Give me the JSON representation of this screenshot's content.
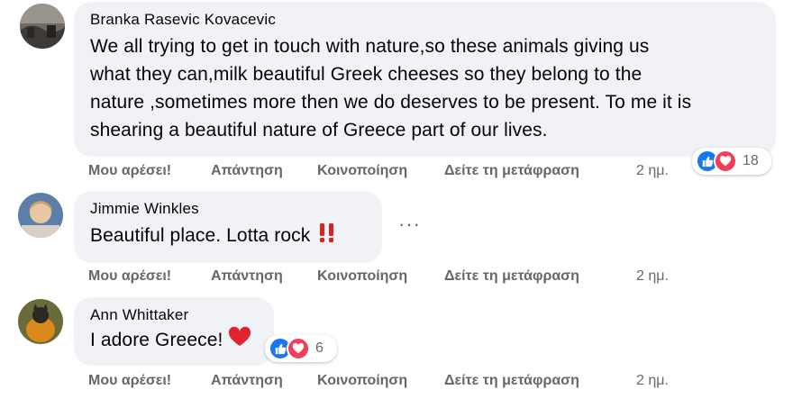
{
  "colors": {
    "bubble": "#f0f2f5",
    "action_text": "#65676b",
    "like_blue": "#1877f2",
    "love_red": "#f33e58",
    "exclamation_red": "#e02020"
  },
  "comments": [
    {
      "author": "Branka Rasevic Kovacevic",
      "lines": [
        "We all trying to get in touch with nature,so these animals giving us",
        "what they can,milk beautiful Greek cheeses so they belong to the",
        "nature ,sometimes more then we do deserves to be present. To me it is",
        "shearing a beautiful nature of Greece part of our lives."
      ],
      "reaction_count": "18",
      "reactions": [
        "like-icon",
        "love-icon"
      ],
      "actions": {
        "like": "Μου αρέσει!",
        "reply": "Απάντηση",
        "share": "Κοινοποίηση",
        "translate": "Δείτε τη μετάφραση",
        "time": "2 ημ."
      }
    },
    {
      "author": "Jimmie Winkles",
      "text": "Beautiful place. Lotta rock",
      "emoji": "double-exclamation-icon",
      "more": "···",
      "actions": {
        "like": "Μου αρέσει!",
        "reply": "Απάντηση",
        "share": "Κοινοποίηση",
        "translate": "Δείτε τη μετάφραση",
        "time": "2 ημ."
      }
    },
    {
      "author": "Ann Whittaker",
      "text": "I adore Greece!",
      "emoji": "red-heart-icon",
      "reaction_count": "6",
      "reactions": [
        "like-icon",
        "love-icon"
      ],
      "actions": {
        "like": "Μου αρέσει!",
        "reply": "Απάντηση",
        "share": "Κοινοποίηση",
        "translate": "Δείτε τη μετάφραση",
        "time": "2 ημ."
      }
    }
  ]
}
